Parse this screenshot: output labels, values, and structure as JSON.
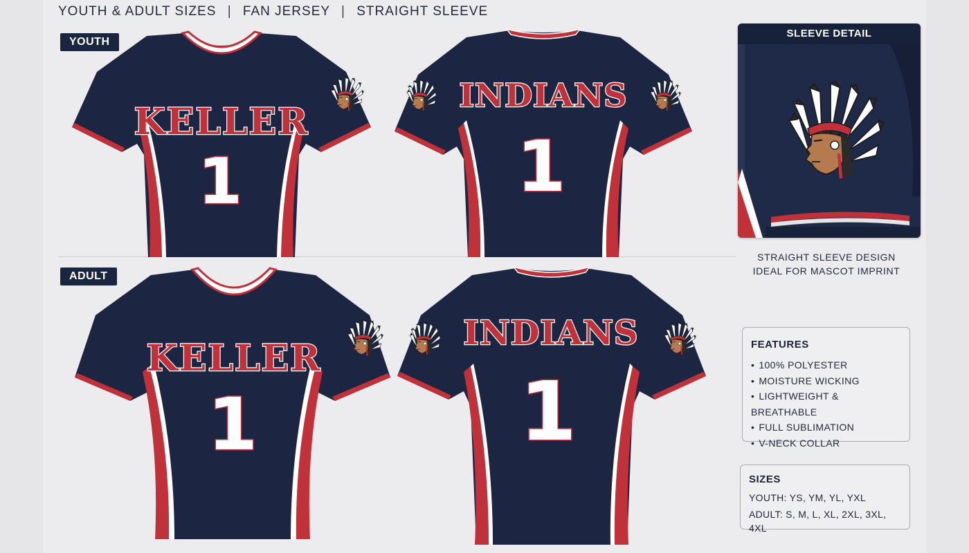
{
  "header": {
    "part1": "YOUTH & ADULT SIZES",
    "part2": "FAN JERSEY",
    "part3": "STRAIGHT SLEEVE",
    "separator": "|"
  },
  "sections": {
    "youth_label": "YOUTH",
    "adult_label": "ADULT"
  },
  "jerseys": {
    "front_word": "KELLER",
    "back_word": "INDIANS",
    "number": "1"
  },
  "colors": {
    "navy": "#1c2642",
    "red": "#c0313a",
    "white": "#ffffff"
  },
  "sleeve_detail": {
    "title": "SLEEVE DETAIL",
    "caption_line1": "STRAIGHT SLEEVE DESIGN",
    "caption_line2": "IDEAL FOR MASCOT IMPRINT",
    "icon": "mascot-headdress-icon"
  },
  "features": {
    "title": "FEATURES",
    "items": [
      "100% POLYESTER",
      "MOISTURE WICKING",
      "LIGHTWEIGHT & BREATHABLE",
      "FULL SUBLIMATION",
      "V-NECK COLLAR"
    ]
  },
  "sizes": {
    "title": "SIZES",
    "youth": "YOUTH: YS, YM, YL, YXL",
    "adult": "ADULT: S, M, L, XL, 2XL, 3XL, 4XL"
  }
}
